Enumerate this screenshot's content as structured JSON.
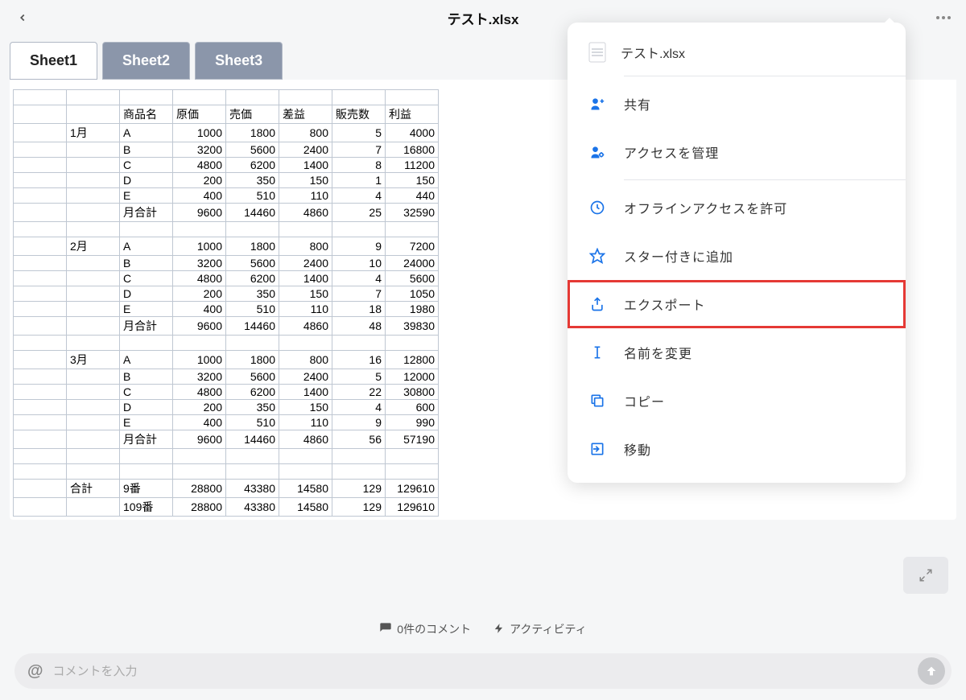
{
  "header": {
    "title": "テスト.xlsx"
  },
  "tabs": [
    {
      "label": "Sheet1",
      "active": true
    },
    {
      "label": "Sheet2",
      "active": false
    },
    {
      "label": "Sheet3",
      "active": false
    }
  ],
  "table": {
    "headers": [
      "",
      "",
      "商品名",
      "原価",
      "売価",
      "差益",
      "販売数",
      "利益"
    ],
    "rows": [
      [
        "",
        "1月",
        "A",
        "1000",
        "1800",
        "800",
        "5",
        "4000"
      ],
      [
        "",
        "",
        "B",
        "3200",
        "5600",
        "2400",
        "7",
        "16800"
      ],
      [
        "",
        "",
        "C",
        "4800",
        "6200",
        "1400",
        "8",
        "11200"
      ],
      [
        "",
        "",
        "D",
        "200",
        "350",
        "150",
        "1",
        "150"
      ],
      [
        "",
        "",
        "E",
        "400",
        "510",
        "110",
        "4",
        "440"
      ],
      [
        "",
        "",
        "月合計",
        "9600",
        "14460",
        "4860",
        "25",
        "32590"
      ],
      [
        "",
        "",
        "",
        "",
        "",
        "",
        "",
        ""
      ],
      [
        "",
        "2月",
        "A",
        "1000",
        "1800",
        "800",
        "9",
        "7200"
      ],
      [
        "",
        "",
        "B",
        "3200",
        "5600",
        "2400",
        "10",
        "24000"
      ],
      [
        "",
        "",
        "C",
        "4800",
        "6200",
        "1400",
        "4",
        "5600"
      ],
      [
        "",
        "",
        "D",
        "200",
        "350",
        "150",
        "7",
        "1050"
      ],
      [
        "",
        "",
        "E",
        "400",
        "510",
        "110",
        "18",
        "1980"
      ],
      [
        "",
        "",
        "月合計",
        "9600",
        "14460",
        "4860",
        "48",
        "39830"
      ],
      [
        "",
        "",
        "",
        "",
        "",
        "",
        "",
        ""
      ],
      [
        "",
        "3月",
        "A",
        "1000",
        "1800",
        "800",
        "16",
        "12800"
      ],
      [
        "",
        "",
        "B",
        "3200",
        "5600",
        "2400",
        "5",
        "12000"
      ],
      [
        "",
        "",
        "C",
        "4800",
        "6200",
        "1400",
        "22",
        "30800"
      ],
      [
        "",
        "",
        "D",
        "200",
        "350",
        "150",
        "4",
        "600"
      ],
      [
        "",
        "",
        "E",
        "400",
        "510",
        "110",
        "9",
        "990"
      ],
      [
        "",
        "",
        "月合計",
        "9600",
        "14460",
        "4860",
        "56",
        "57190"
      ],
      [
        "",
        "",
        "",
        "",
        "",
        "",
        "",
        ""
      ],
      [
        "",
        "",
        "",
        "",
        "",
        "",
        "",
        ""
      ],
      [
        "",
        "合計",
        "9番",
        "28800",
        "43380",
        "14580",
        "129",
        "129610"
      ],
      [
        "",
        "",
        "109番",
        "28800",
        "43380",
        "14580",
        "129",
        "129610"
      ]
    ]
  },
  "menu": {
    "file_name": "テスト.xlsx",
    "items": [
      {
        "label": "共有",
        "icon": "share"
      },
      {
        "label": "アクセスを管理",
        "icon": "manage-access"
      },
      {
        "label": "オフラインアクセスを許可",
        "icon": "offline"
      },
      {
        "label": "スター付きに追加",
        "icon": "star"
      },
      {
        "label": "エクスポート",
        "icon": "export",
        "highlighted": true
      },
      {
        "label": "名前を変更",
        "icon": "rename"
      },
      {
        "label": "コピー",
        "icon": "copy"
      },
      {
        "label": "移動",
        "icon": "move"
      }
    ]
  },
  "bottom": {
    "comments": "0件のコメント",
    "activity": "アクティビティ"
  },
  "comment": {
    "placeholder": "コメントを入力"
  }
}
